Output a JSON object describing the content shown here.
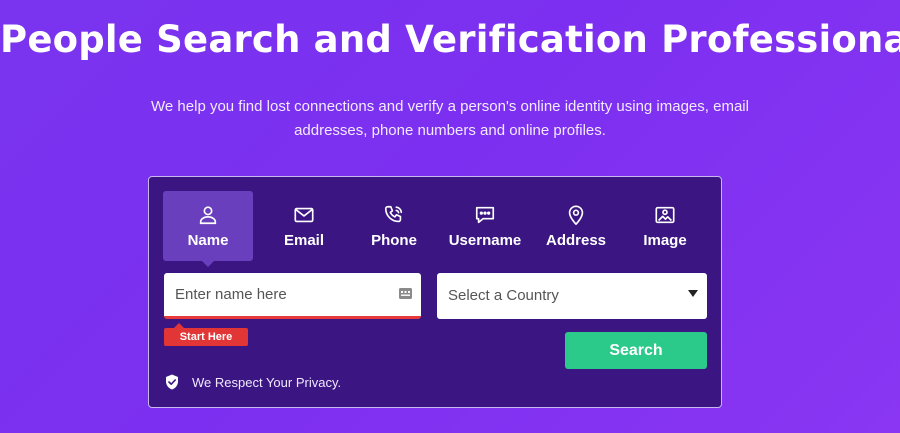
{
  "hero": {
    "title": "People Search and Verification Professionals",
    "subtitle": "We help you find lost connections and verify a person's online identity using images, email addresses, phone numbers and online profiles."
  },
  "search": {
    "tabs": [
      {
        "label": "Name",
        "icon": "user-icon",
        "active": true
      },
      {
        "label": "Email",
        "icon": "envelope-icon",
        "active": false
      },
      {
        "label": "Phone",
        "icon": "phone-icon",
        "active": false
      },
      {
        "label": "Username",
        "icon": "chat-icon",
        "active": false
      },
      {
        "label": "Address",
        "icon": "location-pin-icon",
        "active": false
      },
      {
        "label": "Image",
        "icon": "image-icon",
        "active": false
      }
    ],
    "name_input": {
      "value": "",
      "placeholder": "Enter name here"
    },
    "start_badge": "Start Here",
    "country_select": {
      "selected": "Select a Country"
    },
    "search_button": "Search",
    "privacy_text": "We Respect Your Privacy."
  },
  "colors": {
    "background": "#7a34ef",
    "card": "#3b1682",
    "active_tab": "#6a3fbd",
    "search_button": "#2bc98a",
    "badge": "#e23535"
  }
}
